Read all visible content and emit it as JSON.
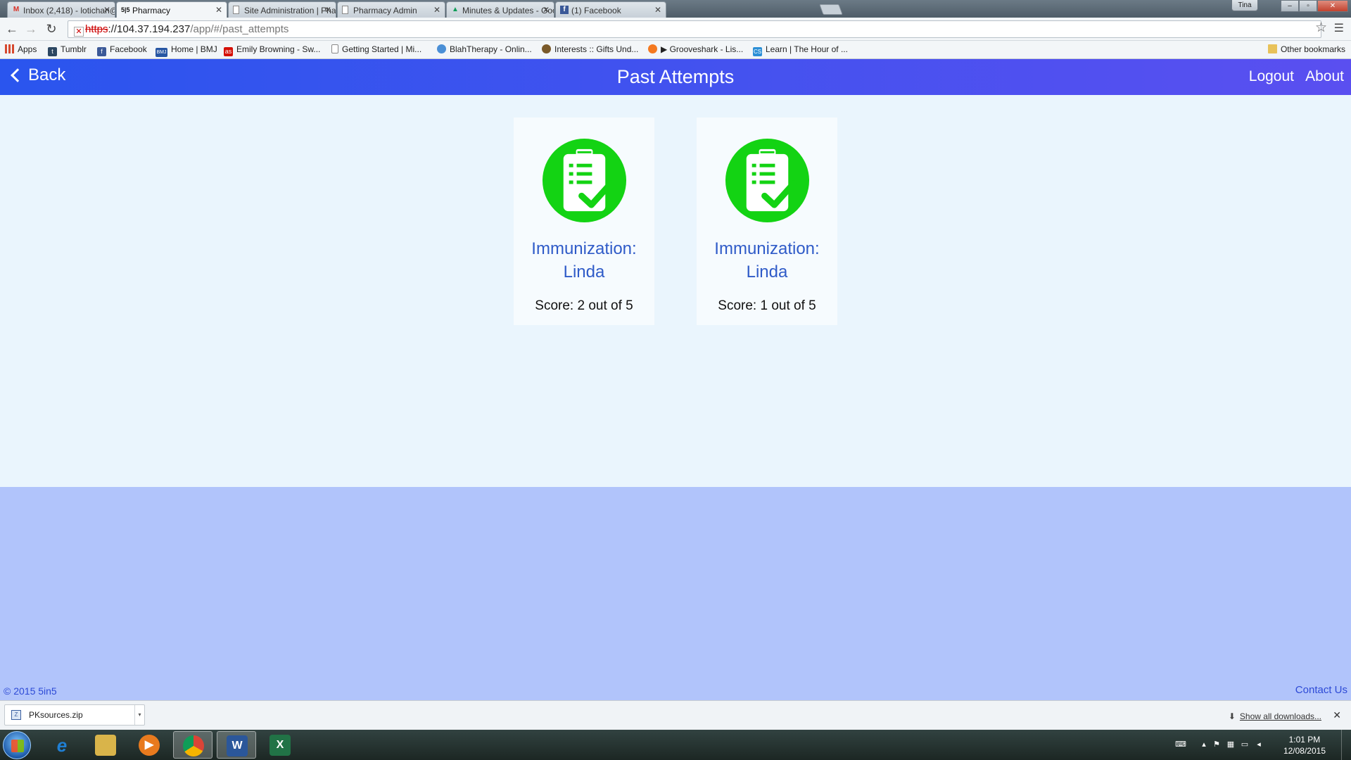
{
  "browser": {
    "tabs": [
      {
        "title": "Inbox (2,418) - lotichan@",
        "icon": "gmail-icon"
      },
      {
        "title": "Pharmacy",
        "icon": "5in5-icon",
        "active": true
      },
      {
        "title": "Site Administration | Phar",
        "icon": "page-icon"
      },
      {
        "title": "Pharmacy Admin",
        "icon": "page-icon"
      },
      {
        "title": "Minutes & Updates - Goo",
        "icon": "drive-icon"
      },
      {
        "title": "(1) Facebook",
        "icon": "facebook-icon"
      }
    ],
    "user_badge": "Tina",
    "url": {
      "https": "https",
      "host": "://104.37.194.237",
      "path": "/app/#/past_attempts"
    },
    "bookmarks": [
      {
        "label": "Apps",
        "icon": "apps-grid-icon",
        "color": "#d6492f"
      },
      {
        "label": "Tumblr",
        "icon": "tumblr-icon",
        "color": "#2c4762"
      },
      {
        "label": "Facebook",
        "icon": "facebook-icon",
        "color": "#3b5998"
      },
      {
        "label": "Home | BMJ",
        "icon": "bmj-icon",
        "color": "#2756a3"
      },
      {
        "label": "Emily Browning - Sw...",
        "icon": "lastfm-icon",
        "color": "#d51007"
      },
      {
        "label": "Getting Started | Mi...",
        "icon": "page-icon",
        "color": "#ffffff"
      },
      {
        "label": "BlahTherapy - Onlin...",
        "icon": "blahtherapy-icon",
        "color": "#4a8fd6"
      },
      {
        "label": "Interests :: Gifts Und...",
        "icon": "gifts-icon",
        "color": "#7a5a2a"
      },
      {
        "label": "▶ Grooveshark - Lis...",
        "icon": "grooveshark-icon",
        "color": "#f47920"
      },
      {
        "label": "Learn | The Hour of ...",
        "icon": "cs-icon",
        "color": "#2b8fd6"
      }
    ],
    "other_bookmarks": "Other bookmarks"
  },
  "app": {
    "back_label": "Back",
    "title": "Past Attempts",
    "logout_label": "Logout",
    "about_label": "About",
    "accent_color": "#2a55ee",
    "icon_color": "#13d313",
    "attempts": [
      {
        "title": "Immunization: Linda",
        "score": "Score: 2 out of 5",
        "icon": "clipboard-check-icon"
      },
      {
        "title": "Immunization: Linda",
        "score": "Score: 1 out of 5",
        "icon": "clipboard-check-icon"
      }
    ],
    "footer": {
      "copyright": "© 2015 5in5",
      "contact": "Contact Us"
    }
  },
  "downloads": {
    "file": "PKsources.zip",
    "show_all": "Show all downloads..."
  },
  "taskbar": {
    "apps": [
      {
        "name": "internet-explorer-icon",
        "glyph": "e",
        "color": "#1f7fd4"
      },
      {
        "name": "file-explorer-icon",
        "glyph": "▤",
        "color": "#d9b44a"
      },
      {
        "name": "media-player-icon",
        "glyph": "▶",
        "color": "#e87a1e"
      },
      {
        "name": "chrome-icon",
        "glyph": "●",
        "color": "#db4437",
        "active": true
      },
      {
        "name": "word-icon",
        "glyph": "W",
        "color": "#2b579a",
        "active": true
      },
      {
        "name": "excel-icon",
        "glyph": "X",
        "color": "#217346"
      }
    ],
    "time": "1:01 PM",
    "date": "12/08/2015"
  }
}
